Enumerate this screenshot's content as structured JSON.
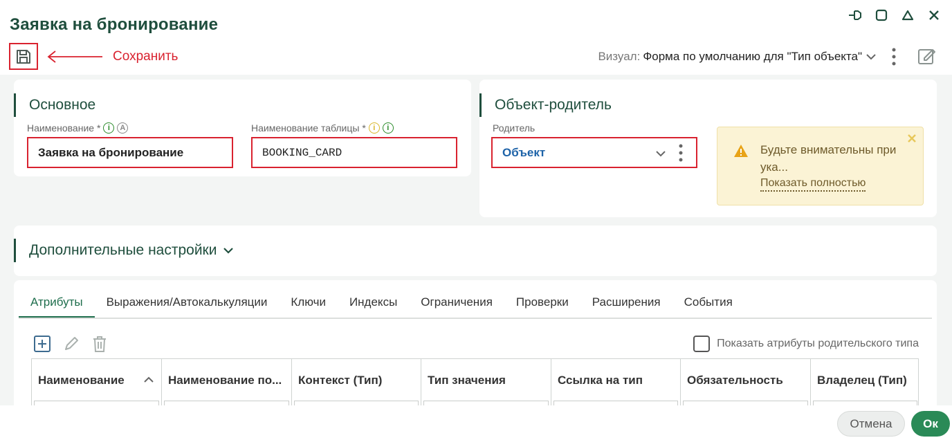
{
  "header": {
    "title": "Заявка на бронирование",
    "annotation": "Сохранить",
    "visual_label": "Визуал:",
    "visual_value": "Форма по умолчанию для \"Тип объекта\""
  },
  "main_card": {
    "title": "Основное",
    "name_label": "Наименование *",
    "name_value": "Заявка на бронирование",
    "table_label": "Наименование таблицы *",
    "table_value": "BOOKING_CARD"
  },
  "parent_card": {
    "title": "Объект-родитель",
    "parent_label": "Родитель",
    "parent_value": "Объект",
    "warning_text": "Будьте внимательны при ука...",
    "warning_link": "Показать полностью"
  },
  "extra": {
    "title": "Дополнительные настройки"
  },
  "tabs": [
    {
      "label": "Атрибуты"
    },
    {
      "label": "Выражения/Автокалькуляции"
    },
    {
      "label": "Ключи"
    },
    {
      "label": "Индексы"
    },
    {
      "label": "Ограничения"
    },
    {
      "label": "Проверки"
    },
    {
      "label": "Расширения"
    },
    {
      "label": "События"
    }
  ],
  "show_parent_attrs": "Показать атрибуты родительского типа",
  "columns": [
    {
      "label": "Наименование"
    },
    {
      "label": "Наименование по..."
    },
    {
      "label": "Контекст (Тип)"
    },
    {
      "label": "Тип значения"
    },
    {
      "label": "Ссылка на тип"
    },
    {
      "label": "Обязательность"
    },
    {
      "label": "Владелец (Тип)"
    }
  ],
  "footer": {
    "cancel": "Отмена",
    "ok": "Ок"
  },
  "colors": {
    "brand": "#1f4e3d",
    "accent_green": "#2a8a57",
    "annotation_red": "#d9222f",
    "link_blue": "#1e63a8"
  }
}
